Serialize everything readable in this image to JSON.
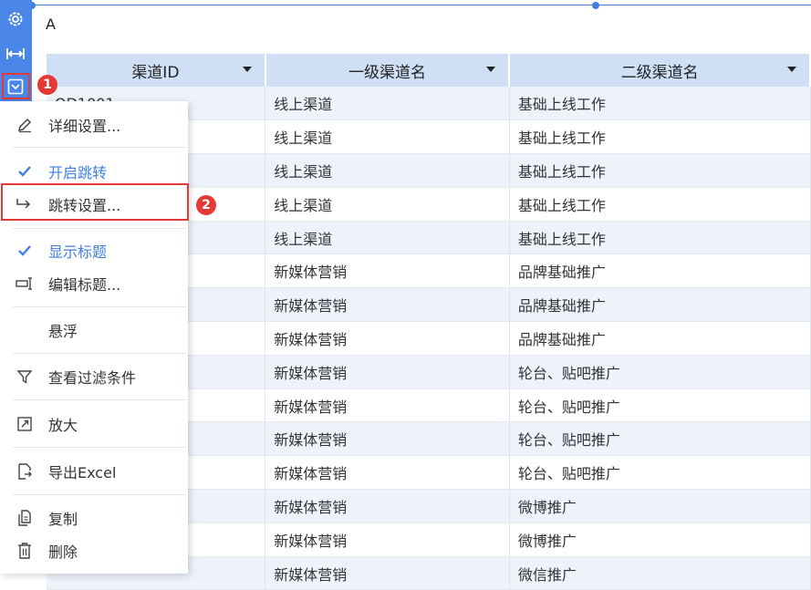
{
  "widget": {
    "title": "A"
  },
  "toolbar": {
    "buttons": [
      {
        "icon": "gear-icon"
      },
      {
        "icon": "fit-width-icon"
      },
      {
        "icon": "chevron-down-icon"
      }
    ]
  },
  "annotations": {
    "badge1": "1",
    "badge2": "2"
  },
  "table": {
    "headers": [
      "渠道ID",
      "一级渠道名",
      "二级渠道名"
    ],
    "rows": [
      [
        "OD1001",
        "线上渠道",
        "基础上线工作"
      ],
      [
        "",
        "线上渠道",
        "基础上线工作"
      ],
      [
        "",
        "线上渠道",
        "基础上线工作"
      ],
      [
        "",
        "线上渠道",
        "基础上线工作"
      ],
      [
        "",
        "线上渠道",
        "基础上线工作"
      ],
      [
        "",
        "新媒体营销",
        "品牌基础推广"
      ],
      [
        "",
        "新媒体营销",
        "品牌基础推广"
      ],
      [
        "",
        "新媒体营销",
        "品牌基础推广"
      ],
      [
        "",
        "新媒体营销",
        "轮台、贴吧推广"
      ],
      [
        "",
        "新媒体营销",
        "轮台、贴吧推广"
      ],
      [
        "",
        "新媒体营销",
        "轮台、贴吧推广"
      ],
      [
        "",
        "新媒体营销",
        "轮台、贴吧推广"
      ],
      [
        "",
        "新媒体营销",
        "微博推广"
      ],
      [
        "",
        "新媒体营销",
        "微博推广"
      ],
      [
        "",
        "新媒体营销",
        "微信推广"
      ]
    ]
  },
  "menu": {
    "items": [
      {
        "label": "详细设置...",
        "icon": "pencil-icon"
      },
      {
        "label": "开启跳转",
        "icon": "check-icon"
      },
      {
        "label": "跳转设置...",
        "icon": "jump-arrow-icon"
      },
      {
        "label": "显示标题",
        "icon": "check-icon"
      },
      {
        "label": "编辑标题...",
        "icon": "edit-title-icon"
      },
      {
        "label": "悬浮",
        "icon": ""
      },
      {
        "label": "查看过滤条件",
        "icon": "filter-icon"
      },
      {
        "label": "放大",
        "icon": "expand-icon"
      },
      {
        "label": "导出Excel",
        "icon": "export-icon"
      },
      {
        "label": "复制",
        "icon": "copy-icon"
      },
      {
        "label": "删除",
        "icon": "trash-icon"
      }
    ]
  },
  "colors": {
    "accent": "#4a86e8",
    "marker": "#e53935",
    "header_bg": "#cfe0f6",
    "row_alt": "#eef3fb"
  }
}
